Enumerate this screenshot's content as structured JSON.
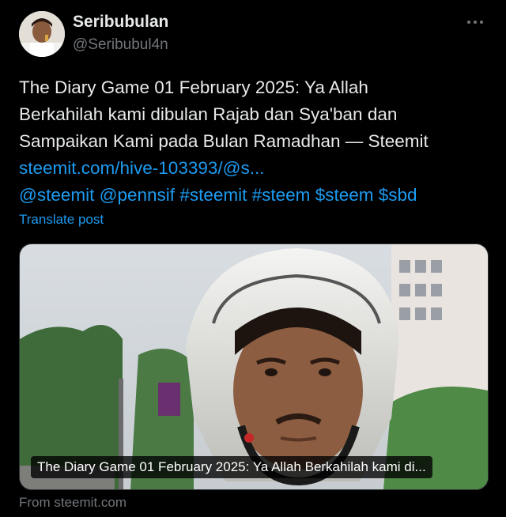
{
  "author": {
    "display_name": "Seribubulan",
    "handle": "@Seribubul4n"
  },
  "more_icon": "ellipsis-icon",
  "tweet": {
    "lines": [
      "The Diary Game 01 February 2025: Ya Allah",
      "Berkahilah kami dibulan Rajab dan Sya'ban dan",
      "Sampaikan Kami pada Bulan Ramadhan — Steemit"
    ],
    "link": "steemit.com/hive-103393/@s...",
    "tags": [
      "@steemit",
      "@pennsif",
      "#steemit",
      "#steem",
      "$steem",
      "$sbd"
    ]
  },
  "translate_label": "Translate post",
  "card": {
    "caption": "The Diary Game 01 February 2025: Ya Allah Berkahilah kami di...",
    "source": "From steemit.com"
  },
  "colors": {
    "background": "#000000",
    "text": "#e7e9ea",
    "secondary": "#71767b",
    "link": "#1d9bf0"
  }
}
